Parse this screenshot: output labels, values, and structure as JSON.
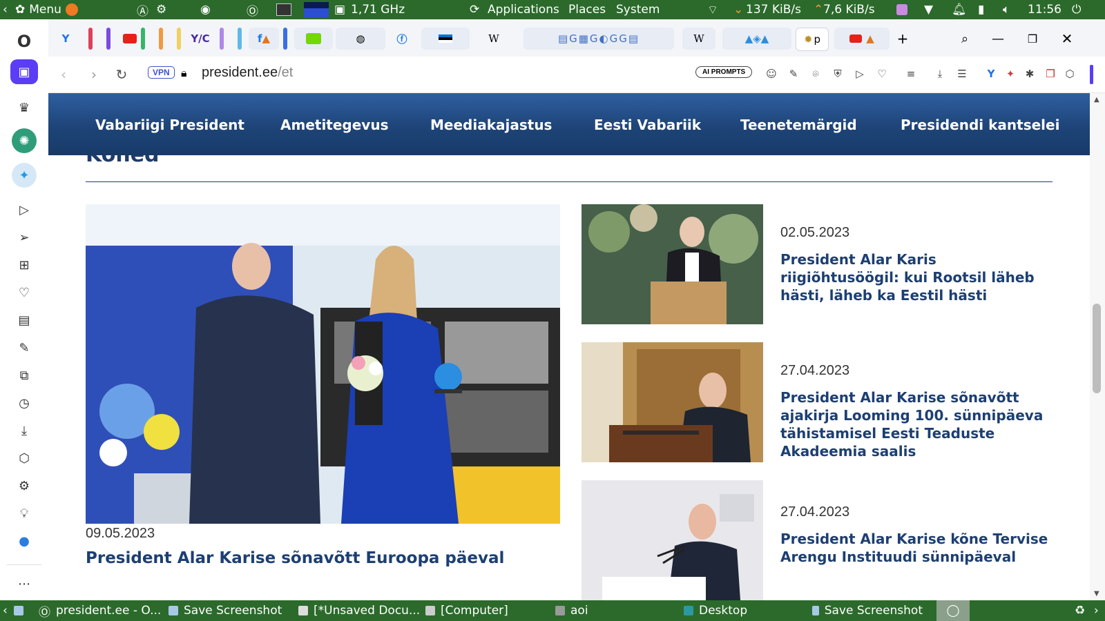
{
  "top_panel": {
    "menu_label": "Menu",
    "cpu_freq": "1,71 GHz",
    "menus": [
      "Applications",
      "Places",
      "System"
    ],
    "net_down": "137 KiB/s",
    "net_up": "7,6 KiB/s",
    "clock": "11:56"
  },
  "browser": {
    "url_domain": "president.ee",
    "url_path": "/et",
    "vpn_label": "VPN",
    "ai_prompts_label": "AI PROMPTS",
    "tab_icons": [
      "opera-logo-icon",
      "vivaldi-icon",
      "red-bar",
      "purple-bar",
      "youtube-icon",
      "green-bar",
      "orange-bar",
      "yellow-bar",
      "yc-icon",
      "purple-bar",
      "blue-bar",
      "facebook-icon",
      "blue-bar",
      "flixbus-icon",
      "purple-bar",
      "facebook-icon",
      "orange-icon",
      "estonia-flag-icon",
      "wikipedia-icon",
      "facebook-icon",
      "wikipedia-icon",
      "estonia-seal-icon",
      "youtube-icon",
      "metamask-icon",
      "new-tab-icon"
    ],
    "active_tab_label": "p"
  },
  "site": {
    "nav": [
      "Vabariigi President",
      "Ametitegevus",
      "Meediakajastus",
      "Eesti Vabariik",
      "Teenetemärgid",
      "Presidendi kantselei"
    ],
    "section_heading": "Kõned",
    "featured": {
      "date": "09.05.2023",
      "title": "President Alar Karise sõnavõtt Euroopa päeval"
    },
    "articles": [
      {
        "date": "02.05.2023",
        "title": "President Alar Karis riigiõhtusöögil: kui Rootsil läheb hästi, läheb ka Eestil hästi"
      },
      {
        "date": "27.04.2023",
        "title": "President Alar Karise sõnavõtt ajakirja Looming 100. sünnipäeva tähistamisel Eesti Teaduste Akadeemia saalis"
      },
      {
        "date": "27.04.2023",
        "title": "President Alar Karise kõne Tervise Arengu Instituudi sünnipäeval"
      }
    ]
  },
  "taskbar": [
    {
      "label": "president.ee - O..."
    },
    {
      "label": "Save Screenshot"
    },
    {
      "label": "[*Unsaved Docu..."
    },
    {
      "label": "[Computer]"
    },
    {
      "label": "aoi"
    },
    {
      "label": "Desktop"
    },
    {
      "label": "Save Screenshot"
    }
  ]
}
